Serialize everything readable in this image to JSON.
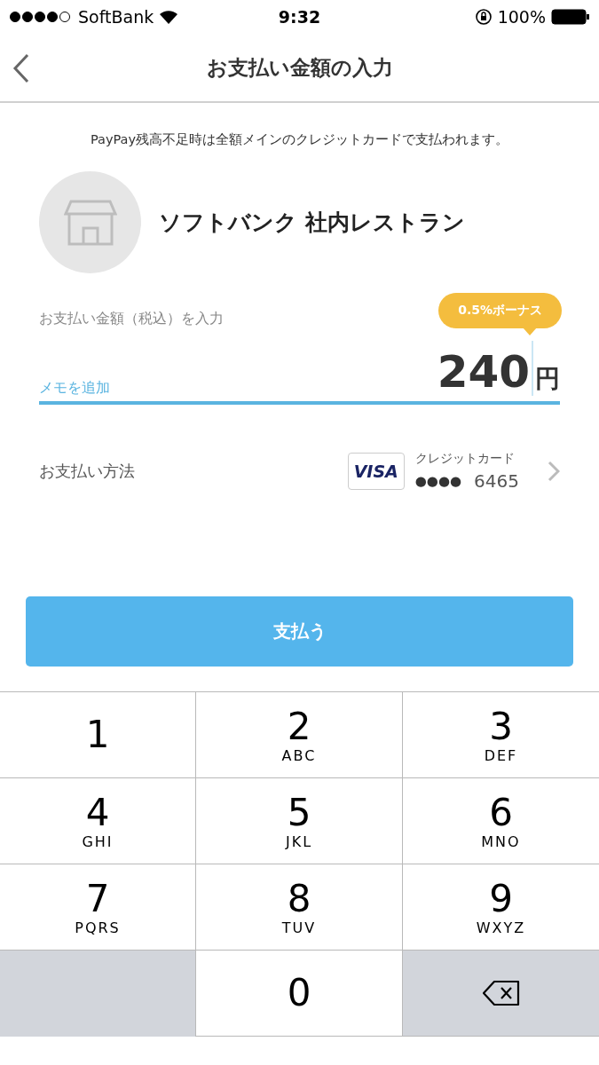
{
  "status_bar": {
    "carrier": "SoftBank",
    "time": "9:32",
    "battery": "100%"
  },
  "nav": {
    "title": "お支払い金額の入力"
  },
  "notice": "PayPay残高不足時は全額メインのクレジットカードで支払われます。",
  "store": {
    "name": "ソフトバンク 社内レストラン"
  },
  "amount": {
    "label": "お支払い金額（税込）を入力",
    "bonus": "0.5%ボーナス",
    "placeholder": "メモを追加",
    "value": "240",
    "unit": "円"
  },
  "payment": {
    "label": "お支払い方法",
    "brand": "VISA",
    "card_type": "クレジットカード",
    "masked": "●●●●",
    "last4": "6465"
  },
  "pay_button": "支払う",
  "keypad": [
    {
      "kind": "digit",
      "digit": "1"
    },
    {
      "kind": "digit",
      "digit": "2",
      "letters": "ABC"
    },
    {
      "kind": "digit",
      "digit": "3",
      "letters": "DEF"
    },
    {
      "kind": "digit",
      "digit": "4",
      "letters": "GHI"
    },
    {
      "kind": "digit",
      "digit": "5",
      "letters": "JKL"
    },
    {
      "kind": "digit",
      "digit": "6",
      "letters": "MNO"
    },
    {
      "kind": "digit",
      "digit": "7",
      "letters": "PQRS"
    },
    {
      "kind": "digit",
      "digit": "8",
      "letters": "TUV"
    },
    {
      "kind": "digit",
      "digit": "9",
      "letters": "WXYZ"
    },
    {
      "kind": "blank"
    },
    {
      "kind": "digit",
      "digit": "0"
    },
    {
      "kind": "delete"
    }
  ]
}
